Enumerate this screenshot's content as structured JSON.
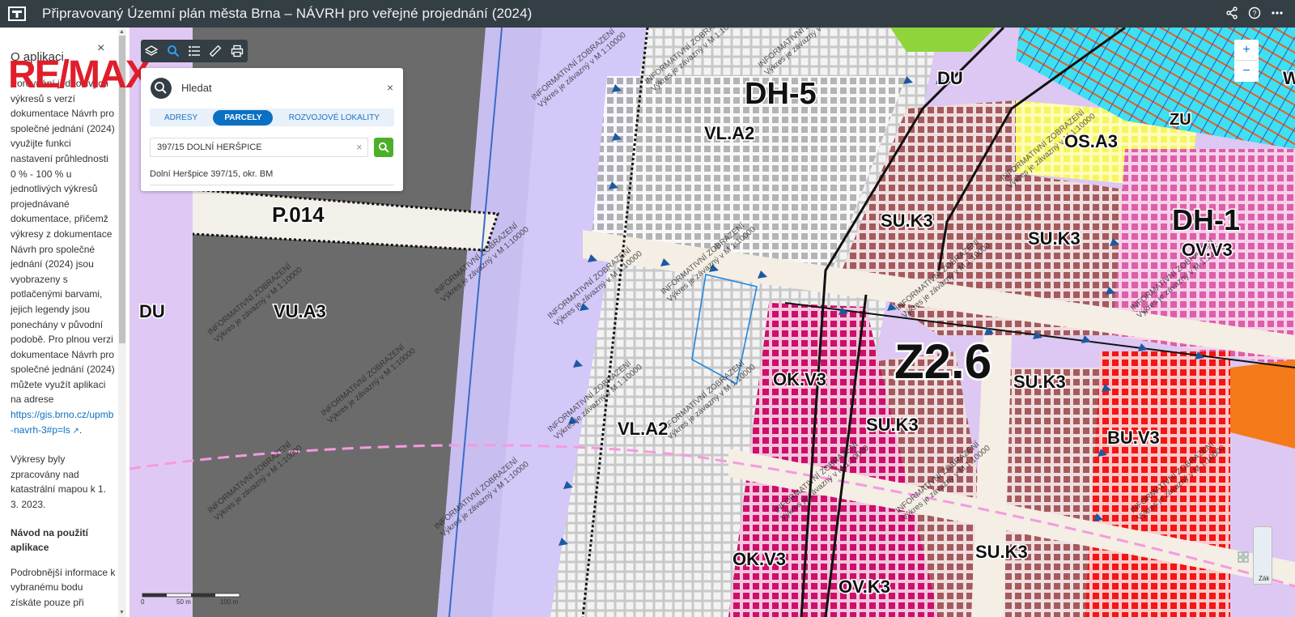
{
  "app": {
    "title": "Připravovaný Územní plán města Brna – NÁVRH pro veřejné projednání (2024)"
  },
  "topbar_icons": [
    "share-icon",
    "help-icon",
    "more-icon"
  ],
  "sidepanel": {
    "heading": "O aplikaci",
    "close": "×",
    "paragraph1": "Porovnání jednotlivých výkresů s verzí dokumentace Návrh pro společné jednání (2024) využijte funkci nastavení průhlednosti 0 % - 100 % u jednotlivých výkresů projednávané dokumentace, přičemž výkresy z dokumentace Návrh pro společné jednání (2024) jsou vyobrazeny s potlačenými barvami, jejich legendy jsou ponechány v původní podobě. Pro plnou verzi dokumentace Návrh pro společné jednání (2024) můžete využít aplikaci na adrese",
    "link": "https://gis.brno.cz/upmb-navrh-3#p=ls",
    "paragraph2": "Výkresy byly zpracovány nad katastrální mapou k 1. 3. 2023.",
    "subheading": "Návod na použití aplikace",
    "paragraph3": "Podrobnější informace k vybranému bodu získáte pouze při"
  },
  "overlay_logo": "RE/MAX",
  "toolbar": {
    "icons": [
      "layers-icon",
      "search-icon",
      "legend-list-icon",
      "measure-ruler-icon",
      "print-icon"
    ]
  },
  "search": {
    "title": "Hledat",
    "close": "×",
    "tabs": [
      {
        "label": "ADRESY",
        "active": false
      },
      {
        "label": "PARCELY",
        "active": true
      },
      {
        "label": "ROZVOJOVÉ LOKALITY",
        "active": false
      }
    ],
    "input_value": "397/15 DOLNÍ HERŠPICE",
    "clear": "×",
    "result": "Dolní Heršpice 397/15, okr. BM"
  },
  "zoom": {
    "in": "+",
    "out": "−"
  },
  "basemap_label": "Zák",
  "scale": {
    "labels": [
      "0",
      "50 m",
      "100 m"
    ]
  },
  "map_labels": {
    "dh5": "DH-5",
    "du_top": "DU",
    "vla2_top": "VL.A2",
    "osa3": "OS.A3",
    "zu": "ZU",
    "dh1": "DH-1",
    "ovv3_right": "OV.V3",
    "p014": "P.014",
    "suk3_a": "SU.K3",
    "suk3_b": "SU.K3",
    "du_left": "DU",
    "vua3": "VU.A3",
    "z26": "Z2.6",
    "okv3_a": "OK.V3",
    "suk3_c": "SU.K3",
    "suk3_d": "SU.K3",
    "vla2_bottom": "VL.A2",
    "buv3": "BU.V3",
    "okv3_b": "OK.V3",
    "suk3_e": "SU.K3",
    "ovk3": "OV.K3",
    "w_edge": "W",
    "watermark_line1": "INFORMATIVNÍ ZOBRAZENÍ",
    "watermark_line2": "Výkres je závazný v M 1:10000"
  }
}
